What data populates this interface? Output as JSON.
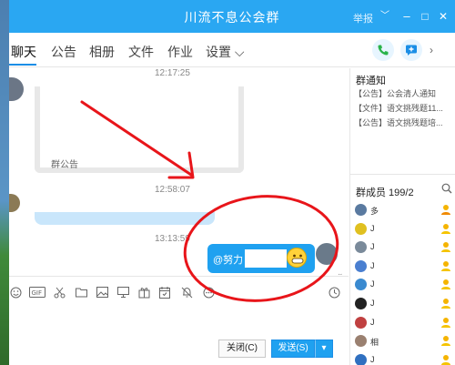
{
  "window": {
    "title": "川流不息公会群",
    "report": "举报",
    "controls": {
      "min": "–",
      "max": "□",
      "close": "✕",
      "dropdown": "﹀"
    }
  },
  "tabs": [
    {
      "label": "聊天",
      "active": true
    },
    {
      "label": "公告"
    },
    {
      "label": "相册"
    },
    {
      "label": "文件"
    },
    {
      "label": "作业"
    },
    {
      "label": "设置 ⌵"
    }
  ],
  "chat": {
    "timestamps": [
      "12:17:25",
      "12:58:07",
      "13:13:59"
    ],
    "notice_card_label": "群公告",
    "my_message_prefix": "@努力",
    "scroll_down": "⌄"
  },
  "input": {
    "close_button": "关闭(C)",
    "send_button": "发送(S)",
    "send_dropdown": "▾"
  },
  "right_panel": {
    "notice_title": "群通知",
    "notices": [
      "【公告】公会清人通知",
      "【文件】语文挑残题11...",
      "【公告】语文挑残题培..."
    ],
    "members_title": "群成员 199/2",
    "members": [
      {
        "name": "多",
        "color": "#5a7aa0",
        "role": "owner"
      },
      {
        "name": "J",
        "color": "#e0c020",
        "role": "admin"
      },
      {
        "name": "J",
        "color": "#7a8a9a",
        "role": "admin"
      },
      {
        "name": "J",
        "color": "#4a7fd0",
        "role": "admin"
      },
      {
        "name": "J",
        "color": "#3a8ad0",
        "role": "admin"
      },
      {
        "name": "J",
        "color": "#222222",
        "role": "admin"
      },
      {
        "name": "J",
        "color": "#c04040",
        "role": "admin"
      },
      {
        "name": "相",
        "color": "#9a8070",
        "role": "admin"
      },
      {
        "name": "J",
        "color": "#3070c0",
        "role": "admin"
      }
    ]
  },
  "colors": {
    "accent": "#2aa7f2",
    "annotation": "#e8151a"
  }
}
